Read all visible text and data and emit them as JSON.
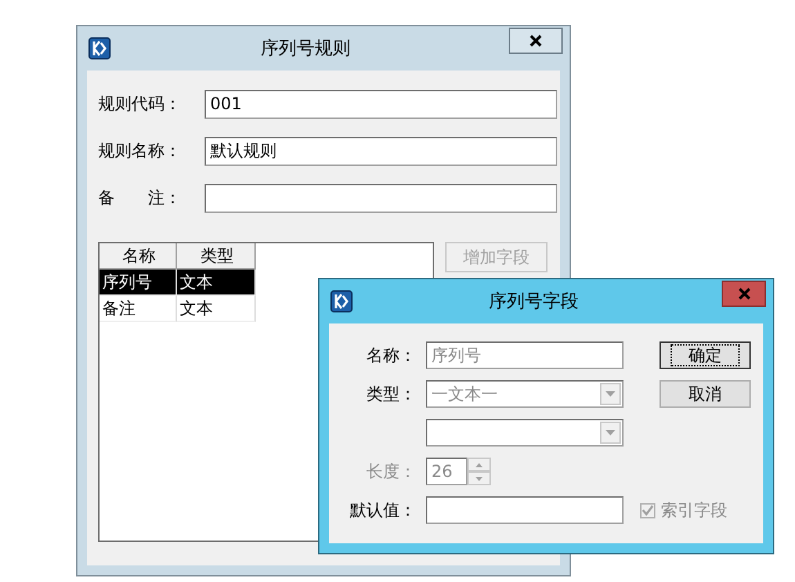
{
  "rule_window": {
    "title": "序列号规则",
    "fields": [
      {
        "label": "规则代码：",
        "value": "001"
      },
      {
        "label": "规则名称：",
        "value": "默认规则"
      },
      {
        "label": "备　　注："
      }
    ],
    "list": {
      "columns": [
        "名称",
        "类型"
      ],
      "rows": [
        {
          "cells": [
            "序列号",
            "文本"
          ],
          "selected": true
        },
        {
          "cells": [
            "备注",
            "文本"
          ],
          "selected": false
        }
      ]
    },
    "add_button": {
      "label": "增加字段",
      "disabled": true
    }
  },
  "field_dialog": {
    "title": "序列号字段",
    "fields": [
      {
        "kind": "text",
        "label": "名称：",
        "value": "序列号",
        "readonly": true
      },
      {
        "kind": "combo",
        "label": "类型：",
        "value": "一文本一",
        "readonly": true
      },
      {
        "kind": "combo"
      },
      {
        "kind": "spin",
        "label": "长度：",
        "value": "26",
        "disabled": true
      },
      {
        "kind": "text",
        "label": "默认值："
      }
    ],
    "buttons": [
      {
        "label": "确定",
        "default": true
      },
      {
        "label": "取消",
        "default": false
      }
    ],
    "checkbox": {
      "label": "索引字段",
      "checked": true,
      "disabled": true
    }
  }
}
